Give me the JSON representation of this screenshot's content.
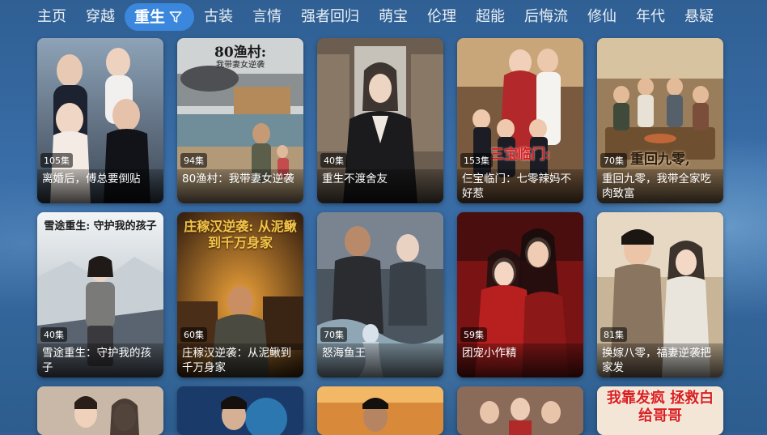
{
  "nav": {
    "items": [
      "主页",
      "穿越",
      "重生",
      "古装",
      "言情",
      "强者回归",
      "萌宝",
      "伦理",
      "超能",
      "后悔流",
      "修仙",
      "年代",
      "悬疑"
    ],
    "active_index": 2,
    "active_icon": "filter-icon"
  },
  "colors": {
    "background": "#3a6ea8",
    "active_tab": "#3b87dd",
    "text": "#ffffff"
  },
  "cards": [
    {
      "title": "离婚后，傅总要倒贴",
      "episodes": "105集",
      "poster_text": "",
      "poster_sub": ""
    },
    {
      "title": "80渔村：我带妻女逆袭",
      "episodes": "94集",
      "poster_text": "80渔村:",
      "poster_sub": "我带妻女逆袭"
    },
    {
      "title": "重生不渡舍友",
      "episodes": "40集",
      "poster_text": "",
      "poster_sub": ""
    },
    {
      "title": "仨宝临门：七零辣妈不好惹",
      "episodes": "153集",
      "poster_text": "三宝临门:",
      "poster_sub": ""
    },
    {
      "title": "重回九零，我带全家吃肉致富",
      "episodes": "70集",
      "poster_text": "重回九零,",
      "poster_sub": ""
    },
    {
      "title": "雪途重生：守护我的孩子",
      "episodes": "40集",
      "poster_text": "雪途重生: 守护我的孩子",
      "poster_sub": ""
    },
    {
      "title": "庄稼汉逆袭：从泥鳅到千万身家",
      "episodes": "60集",
      "poster_text": "庄稼汉逆袭: 从泥鳅到千万身家",
      "poster_sub": ""
    },
    {
      "title": "怒海鱼王",
      "episodes": "70集",
      "poster_text": "",
      "poster_sub": ""
    },
    {
      "title": "团宠小作精",
      "episodes": "59集",
      "poster_text": "",
      "poster_sub": ""
    },
    {
      "title": "换嫁八零，福妻逆袭把家发",
      "episodes": "81集",
      "poster_text": "",
      "poster_sub": ""
    }
  ],
  "partial_row": {
    "poster_texts": [
      "",
      "",
      "",
      "",
      "我靠发疯 拯救白给哥哥"
    ]
  }
}
